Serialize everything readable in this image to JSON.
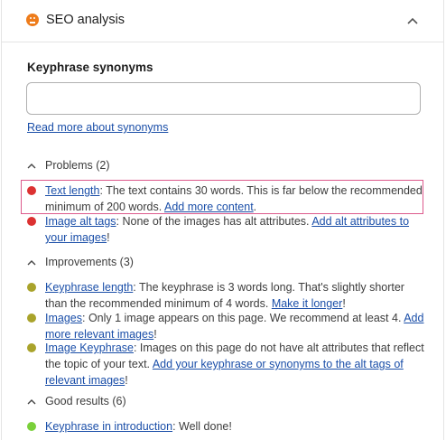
{
  "header": {
    "title": "SEO analysis",
    "status_color": "#ee7c1b",
    "status_icon": "face-sad-icon",
    "toggle_icon": "chevron-up-icon"
  },
  "synonyms": {
    "label": "Keyphrase synonyms",
    "value": "",
    "placeholder": "",
    "read_more": "Read more about synonyms"
  },
  "problems": {
    "heading": "Problems (2)",
    "items": [
      {
        "link": "Text length",
        "text": ": The text contains 30 words. This is far below the recommended minimum of 200 words. ",
        "action": "Add more content",
        "end": "."
      },
      {
        "link": "Image alt tags",
        "text": ": None of the images has alt attributes. ",
        "action": "Add alt attributes to your images",
        "end": "!"
      }
    ]
  },
  "improvements": {
    "heading": "Improvements (3)",
    "items": [
      {
        "link": "Keyphrase length",
        "text": ": The keyphrase is 3 words long. That's slightly shorter than the recommended minimum of 4 words. ",
        "action": "Make it longer",
        "end": "!"
      },
      {
        "link": "Images",
        "text": ": Only 1 image appears on this page. We recommend at least 4. ",
        "action": "Add more relevant images",
        "end": "!"
      },
      {
        "link": "Image Keyphrase",
        "text": ": Images on this page do not have alt attributes that reflect the topic of your text. ",
        "action": "Add your keyphrase or synonyms to the alt tags of relevant images",
        "end": "!"
      }
    ]
  },
  "good": {
    "heading": "Good results (6)",
    "items": [
      {
        "link": "Keyphrase in introduction",
        "text": ": Well done!"
      }
    ]
  },
  "colors": {
    "problem": "#dc3232",
    "improvement": "#a9a32b",
    "good": "#7ad03a",
    "link": "#1a4ea8",
    "highlight": "#dc5a8c"
  }
}
